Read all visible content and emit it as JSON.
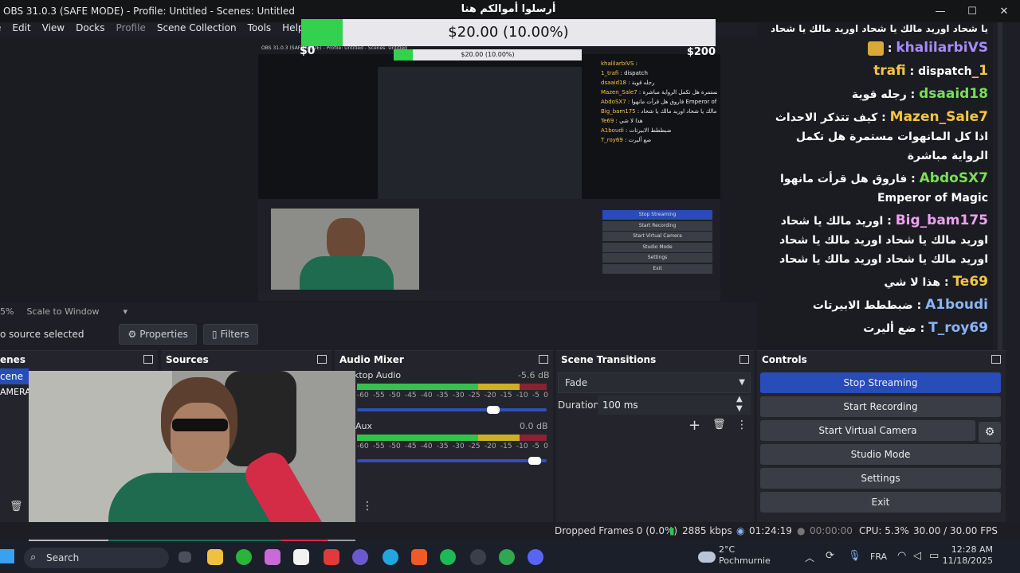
{
  "window": {
    "title": "OBS 31.0.3 (SAFE MODE) - Profile: Untitled - Scenes: Untitled"
  },
  "menu": [
    "Edit",
    "View",
    "Docks",
    "Profile",
    "Scene Collection",
    "Tools",
    "Help"
  ],
  "menu_leading": "e",
  "donation": {
    "title": "أرسلوا أموالكم هنا",
    "amount_text": "$20.00 (10.00%)",
    "progress_fraction": 0.1,
    "start_label": "$0",
    "goal_label": "$200"
  },
  "chat": [
    {
      "user": "khalilarbiVS",
      "text": "",
      "user_color": "#a78bfa"
    },
    {
      "user": "1_trafi",
      "text": "dispatch",
      "user_color": "#f5c542"
    },
    {
      "user": "dsaaid18",
      "text": "رجله قوية",
      "user_color": "#7ddc5a"
    },
    {
      "user": "Mazen_Sale7",
      "text": "كيف تتذكر الاحداث اذا كل المانهوات مستمرة هل تكمل الرواية مباشرة",
      "user_color": "#f5c542"
    },
    {
      "user": "AbdoSX7",
      "text": "فاروق هل قرأت مانهوا Emperor of Magic",
      "user_color": "#7ddc5a"
    },
    {
      "user": "Big_bam175",
      "text": "اوريد مالك يا شحاد اوريد مالك يا شحاد اوريد مالك يا شحاد اوريد مالك يا شحاد اوريد مالك يا شحاد",
      "user_color": "#f0a0f0"
    },
    {
      "user": "Te69",
      "text": "هذا لا شي",
      "user_color": "#f5c542"
    },
    {
      "user": "A1boudi",
      "text": "ضبططط الابيرتات",
      "user_color": "#8ab4f8"
    },
    {
      "user": "T_roy69",
      "text": "ضع أليرت",
      "user_color": "#8ab4f8"
    }
  ],
  "chat_top_partial": "يا شحاد اوريد مالك يا شحاد اوريد مالك يا شحاد",
  "preview_toolbar": {
    "scale_prefix": "5%",
    "scale_label": "Scale to Window"
  },
  "context": {
    "no_source": "o source selected",
    "properties_label": "Properties",
    "filters_label": "Filters"
  },
  "docks": {
    "scenes": {
      "title": "enes",
      "items": [
        "cene",
        "AMERA"
      ]
    },
    "sources": {
      "title": "Sources"
    },
    "mixer": {
      "title": "Audio Mixer",
      "channels": [
        {
          "name": "ktop Audio",
          "db": "-5.6 dB",
          "level": 0.86,
          "volume": 0.75
        },
        {
          "name": "Aux",
          "db": "0.0 dB",
          "level": 0.86,
          "volume": 0.97
        }
      ],
      "scale": [
        "-60",
        "-55",
        "-50",
        "-45",
        "-40",
        "-35",
        "-30",
        "-25",
        "-20",
        "-15",
        "-10",
        "-5",
        "0"
      ]
    },
    "transitions": {
      "title": "Scene Transitions",
      "selected": "Fade",
      "duration_label": "Duration",
      "duration_value": "100 ms"
    },
    "controls": {
      "title": "Controls",
      "buttons": [
        "Stop Streaming",
        "Start Recording",
        "Start Virtual Camera",
        "Studio Mode",
        "Settings",
        "Exit"
      ]
    }
  },
  "status": {
    "dropped": "Dropped Frames 0 (0.0%)",
    "bitrate": "2885 kbps",
    "stream_time": "01:24:19",
    "rec_time": "00:00:00",
    "cpu": "CPU: 5.3%",
    "fps": "30.00 / 30.00 FPS"
  },
  "taskbar": {
    "search_label": "Search",
    "weather_temp": "2°C",
    "weather_place": "Pochmurnie",
    "language": "FRA",
    "time": "12:28 AM",
    "date": "11/18/2025"
  },
  "colors": {
    "accent": "#284cb8",
    "progress_green": "#33d14e"
  }
}
